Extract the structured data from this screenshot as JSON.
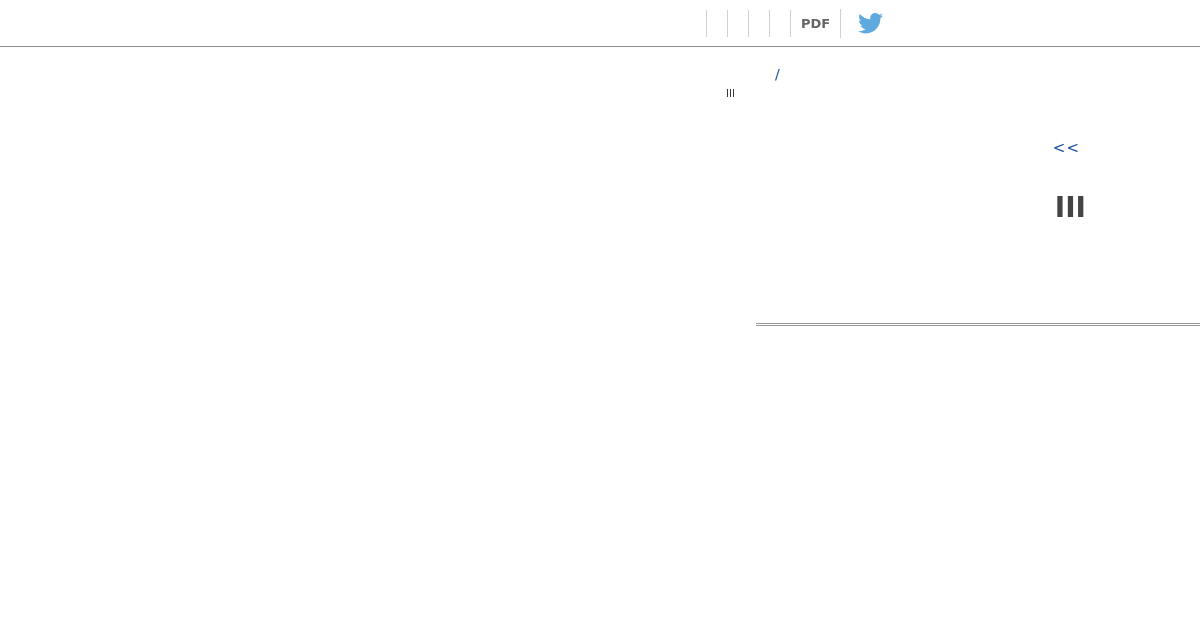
{
  "toolbar": {
    "pdf_label": "PDF"
  },
  "breadcrumb": {
    "separator": "/"
  },
  "small_label": "III",
  "panel": {
    "back_link": "<<",
    "large_label": "III"
  }
}
